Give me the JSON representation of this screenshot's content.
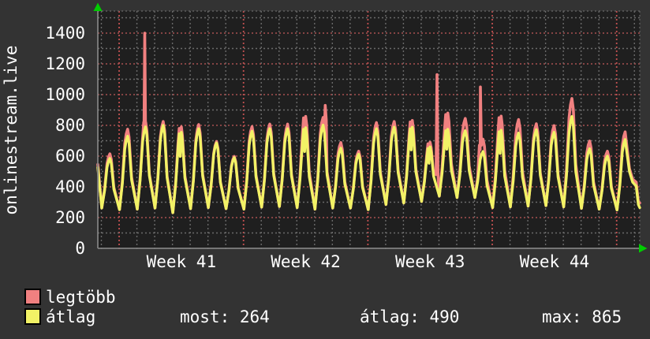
{
  "colors": {
    "background": "#333333",
    "canvas": "#1f1f1f",
    "text": "#ffffff",
    "axis": "#808080",
    "arrow": "#00cc00",
    "grid_major": "#a85050",
    "grid_minor": "#6a6a6a",
    "week_line": "#c05050",
    "canvas_border": "#5d5d5d",
    "series_max": "#f08080",
    "series_avg": "#f2f266",
    "swatch_border": "#000000"
  },
  "legend": [
    {
      "label": "legtöbb",
      "color": "#f08080"
    },
    {
      "label": "átlag",
      "color": "#f2f266"
    }
  ],
  "stats": [
    "most: 264",
    "átlag: 490",
    "max: 865"
  ],
  "chart_data": {
    "type": "line",
    "title": "",
    "ylabel": "onlinestream.live",
    "xlabel": "",
    "ylim": [
      0,
      1545
    ],
    "x_axis_span_days": 30.5,
    "y_ticks": [
      0,
      200,
      400,
      600,
      800,
      1000,
      1200,
      1400
    ],
    "y_minor_ticks": [
      100,
      300,
      500,
      700,
      900,
      1100,
      1300,
      1500
    ],
    "x_ticks": [
      {
        "label": "Week 41",
        "day": 4.7
      },
      {
        "label": "Week 42",
        "day": 11.7
      },
      {
        "label": "Week 43",
        "day": 18.7
      },
      {
        "label": "Week 44",
        "day": 25.7
      }
    ],
    "week_line_days": [
      1.2,
      8.2,
      15.2,
      22.2,
      29.2
    ],
    "day_grid_start": 0.2,
    "day_grid_count": 31,
    "grid": {
      "horizontal": true,
      "vertical": true,
      "style": "dotted"
    },
    "legend_position": "bottom-left",
    "series": [
      {
        "name": "legtöbb",
        "key": "max",
        "color": "#f08080",
        "width": 3.6
      },
      {
        "name": "átlag",
        "key": "avg",
        "color": "#f2f266",
        "width": 3.4
      }
    ],
    "start": {
      "max": 545,
      "avg": 525,
      "first_trough": 262
    },
    "days": [
      {
        "max": 615,
        "avg": 585,
        "trough": 252
      },
      {
        "max": 775,
        "avg": 730,
        "trough": 255
      },
      {
        "max": 820,
        "avg": 790,
        "trough": 262
      },
      {
        "max": 825,
        "avg": 800,
        "trough": 232
      },
      {
        "max": 790,
        "avg": 755,
        "trough": 258,
        "dt": true
      },
      {
        "max": 805,
        "avg": 778,
        "trough": 265
      },
      {
        "max": 695,
        "avg": 685,
        "trough": 258
      },
      {
        "max": 598,
        "avg": 590,
        "trough": 255
      },
      {
        "max": 792,
        "avg": 762,
        "trough": 268
      },
      {
        "max": 808,
        "avg": 778,
        "trough": 272
      },
      {
        "max": 808,
        "avg": 778,
        "trough": 265
      },
      {
        "max": 858,
        "avg": 785,
        "trough": 255,
        "dt": true
      },
      {
        "max": 852,
        "avg": 802,
        "trough": 262
      },
      {
        "max": 688,
        "avg": 652,
        "trough": 262
      },
      {
        "max": 632,
        "avg": 612,
        "trough": 252
      },
      {
        "max": 818,
        "avg": 778,
        "trough": 285
      },
      {
        "max": 825,
        "avg": 788,
        "trough": 295
      },
      {
        "max": 832,
        "avg": 788,
        "trough": 305,
        "dt": true
      },
      {
        "max": 690,
        "avg": 660,
        "trough": 340,
        "dt": true
      },
      {
        "max": 880,
        "avg": 775,
        "trough": 330,
        "dt": true
      },
      {
        "max": 845,
        "avg": 765,
        "trough": 330
      },
      {
        "max": 710,
        "avg": 630,
        "trough": 265
      },
      {
        "max": 860,
        "avg": 768,
        "trough": 270,
        "dt": true
      },
      {
        "max": 838,
        "avg": 750,
        "trough": 275
      },
      {
        "max": 810,
        "avg": 772,
        "trough": 278
      },
      {
        "max": 798,
        "avg": 755,
        "trough": 270
      },
      {
        "max": 975,
        "avg": 858,
        "trough": 260
      },
      {
        "max": 698,
        "avg": 648,
        "trough": 255
      },
      {
        "max": 632,
        "avg": 600,
        "trough": 250
      },
      {
        "max": 758,
        "avg": 708,
        "trough": 250
      }
    ],
    "spikes_max_series": [
      {
        "day": 2.64,
        "value": 1400,
        "base": 820
      },
      {
        "day": 12.8,
        "value": 930,
        "base": 835
      },
      {
        "day": 19.09,
        "value": 1130,
        "base": 480
      },
      {
        "day": 21.53,
        "value": 1050,
        "base": 670
      }
    ],
    "tail": {
      "max": [
        [
          29.92,
          520
        ],
        [
          30.1,
          450
        ],
        [
          30.3,
          430
        ],
        [
          30.42,
          305
        ],
        [
          30.5,
          295
        ]
      ],
      "avg": [
        [
          29.92,
          500
        ],
        [
          30.1,
          430
        ],
        [
          30.3,
          405
        ],
        [
          30.42,
          285
        ],
        [
          30.5,
          264
        ]
      ]
    },
    "printed_stats": {
      "most": 264,
      "atlag": 490,
      "max": 865
    }
  }
}
